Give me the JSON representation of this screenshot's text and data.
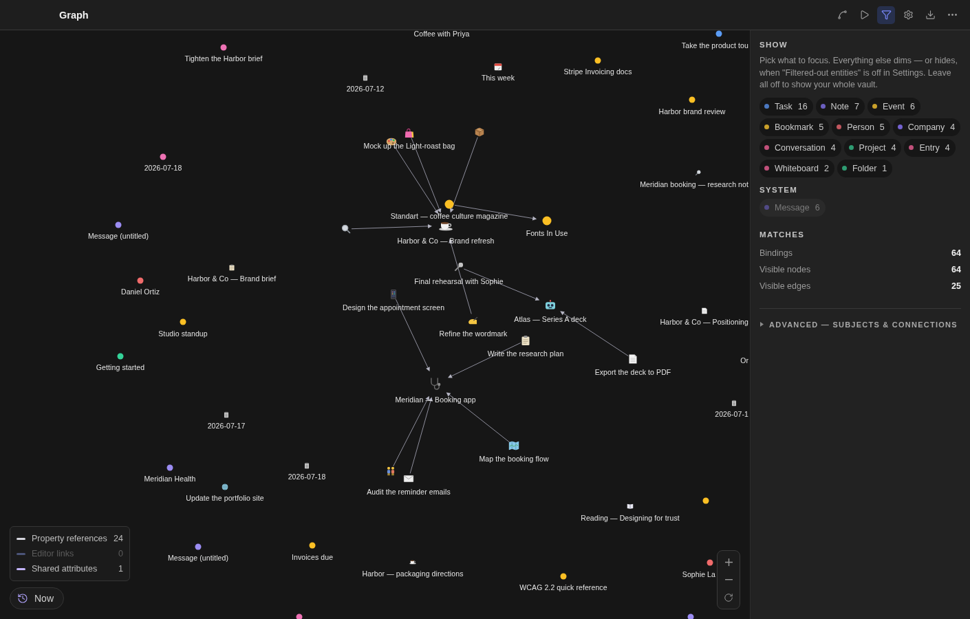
{
  "toolbar": {
    "title": "Graph",
    "tools": [
      {
        "kind": "connections",
        "selected": false
      },
      {
        "kind": "play",
        "selected": false
      },
      {
        "kind": "filter",
        "selected": true
      },
      {
        "kind": "settings",
        "selected": false
      },
      {
        "kind": "export",
        "selected": false
      },
      {
        "kind": "more",
        "selected": false
      }
    ]
  },
  "graph": {
    "nodes": [
      {
        "label": "Coffee with Priya",
        "kind": "label"
      },
      {
        "label": "Take the product tou",
        "kind": "dot",
        "color": "#5b9cf5"
      },
      {
        "label": "Tighten the Harbor brief",
        "kind": "dot",
        "color": "#ee72b4"
      },
      {
        "label": "This week",
        "kind": "icon"
      },
      {
        "label": "Stripe Invoicing docs",
        "kind": "dot",
        "color": "#fbbf24"
      },
      {
        "label": "2026-07-12",
        "kind": "icon"
      },
      {
        "label": "Harbor brand review",
        "kind": "dot",
        "color": "#fbbf24"
      },
      {
        "kind": "icon"
      },
      {
        "label": "Mock up the Light-roast bag",
        "kind": "icon"
      },
      {
        "kind": "icon"
      },
      {
        "label": "2026-07-18",
        "kind": "dot",
        "color": "#ee72b4"
      },
      {
        "label": "Meridian booking — research not",
        "kind": "icon"
      },
      {
        "label": "Standart — coffee culture magazine",
        "kind": "dot",
        "color": "#fbbf24"
      },
      {
        "kind": "icon"
      },
      {
        "label": "Message (untitled)",
        "kind": "dot",
        "color": "#9b8cf2"
      },
      {
        "label": "Harbor & Co — Brand refresh",
        "kind": "icon"
      },
      {
        "label": "Fonts In Use",
        "kind": "dot",
        "color": "#fbbf24"
      },
      {
        "label": "Harbor & Co — Brand brief",
        "kind": "icon"
      },
      {
        "label": "Final rehearsal with Sophie",
        "kind": "icon"
      },
      {
        "label": "Daniel Ortiz",
        "kind": "dot",
        "color": "#f06b6b"
      },
      {
        "label": "Design the appointment screen",
        "kind": "icon"
      },
      {
        "label": "Atlas — Series A deck",
        "kind": "icon"
      },
      {
        "label": "Harbor & Co — Positioning",
        "kind": "icon"
      },
      {
        "label": "Studio standup",
        "kind": "dot",
        "color": "#fbbf24"
      },
      {
        "label": "Refine the wordmark",
        "kind": "icon"
      },
      {
        "label": "Write the research plan",
        "kind": "icon"
      },
      {
        "label": "Getting started",
        "kind": "dot",
        "color": "#34d399"
      },
      {
        "label": "Or",
        "kind": "label"
      },
      {
        "label": "Export the deck to PDF",
        "kind": "icon"
      },
      {
        "label": "Meridian — Booking app",
        "kind": "icon"
      },
      {
        "label": "2026-07-1",
        "kind": "icon"
      },
      {
        "label": "2026-07-17",
        "kind": "icon"
      },
      {
        "label": "Map the booking flow",
        "kind": "icon"
      },
      {
        "kind": "icon"
      },
      {
        "label": "Meridian Health",
        "kind": "dot",
        "color": "#9b8cf2"
      },
      {
        "label": "2026-07-18",
        "kind": "icon"
      },
      {
        "label": "Update the portfolio site",
        "kind": "icon"
      },
      {
        "label": "Audit the reminder emails",
        "kind": "icon"
      },
      {
        "kind": "dot",
        "color": "#fbbf24"
      },
      {
        "label": "Reading — Designing for trust",
        "kind": "icon"
      },
      {
        "label": "Message (untitled)",
        "kind": "dot",
        "color": "#9b8cf2"
      },
      {
        "label": "Invoices due",
        "kind": "dot",
        "color": "#fbbf24"
      },
      {
        "label": "Harbor — packaging directions",
        "kind": "icon"
      },
      {
        "label": "Sophie La",
        "kind": "dot",
        "color": "#f06b6b"
      },
      {
        "label": "WCAG 2.2 quick reference",
        "kind": "dot",
        "color": "#fbbf24"
      },
      {
        "kind": "dot",
        "color": "#ee72b4"
      },
      {
        "kind": "dot",
        "color": "#9b8cf2"
      }
    ],
    "legend": [
      {
        "label": "Property references",
        "count": "24",
        "color": "#d6d6de",
        "enabled": true
      },
      {
        "label": "Editor links",
        "count": "0",
        "color": "#4b5478",
        "enabled": false
      },
      {
        "label": "Shared attributes",
        "count": "1",
        "color": "#c4b5fd",
        "enabled": true
      }
    ],
    "time_button": {
      "label": "Now"
    }
  },
  "filter_panel": {
    "sections": [
      {
        "heading": "SHOW",
        "description": "Pick what to focus. Everything else dims — or hides, when \"Filtered-out entities\" is off in Settings. Leave all off to show your whole vault.",
        "chips": [
          {
            "label": "Task",
            "count": "16",
            "color": "#4b78c0",
            "selected": false,
            "disabled": false
          },
          {
            "label": "Note",
            "count": "7",
            "color": "#6b5fc0",
            "selected": false,
            "disabled": false
          },
          {
            "label": "Event",
            "count": "6",
            "color": "#c9a02a",
            "selected": false,
            "disabled": false
          },
          {
            "label": "Bookmark",
            "count": "5",
            "color": "#c9a02a",
            "selected": false,
            "disabled": false
          },
          {
            "label": "Person",
            "count": "5",
            "color": "#c0565e",
            "selected": false,
            "disabled": false
          },
          {
            "label": "Company",
            "count": "4",
            "color": "#7462d0",
            "selected": false,
            "disabled": false
          },
          {
            "label": "Conversation",
            "count": "4",
            "color": "#c0507a",
            "selected": false,
            "disabled": false
          },
          {
            "label": "Project",
            "count": "4",
            "color": "#2e9c72",
            "selected": false,
            "disabled": false
          },
          {
            "label": "Entry",
            "count": "4",
            "color": "#c0507a",
            "selected": false,
            "disabled": false
          },
          {
            "label": "Whiteboard",
            "count": "2",
            "color": "#c0507a",
            "selected": false,
            "disabled": false
          },
          {
            "label": "Folder",
            "count": "1",
            "color": "#2e9c72",
            "selected": false,
            "disabled": false
          }
        ]
      },
      {
        "heading": "SYSTEM",
        "chips": [
          {
            "label": "Message",
            "count": "6",
            "color": "#514a86",
            "selected": false,
            "disabled": true
          }
        ]
      }
    ],
    "matches": {
      "heading": "MATCHES",
      "rows": [
        {
          "label": "Bindings",
          "value": "64"
        },
        {
          "label": "Visible nodes",
          "value": "64"
        },
        {
          "label": "Visible edges",
          "value": "25"
        }
      ]
    },
    "advanced": {
      "label": "ADVANCED — SUBJECTS & CONNECTIONS",
      "expanded": false
    }
  }
}
